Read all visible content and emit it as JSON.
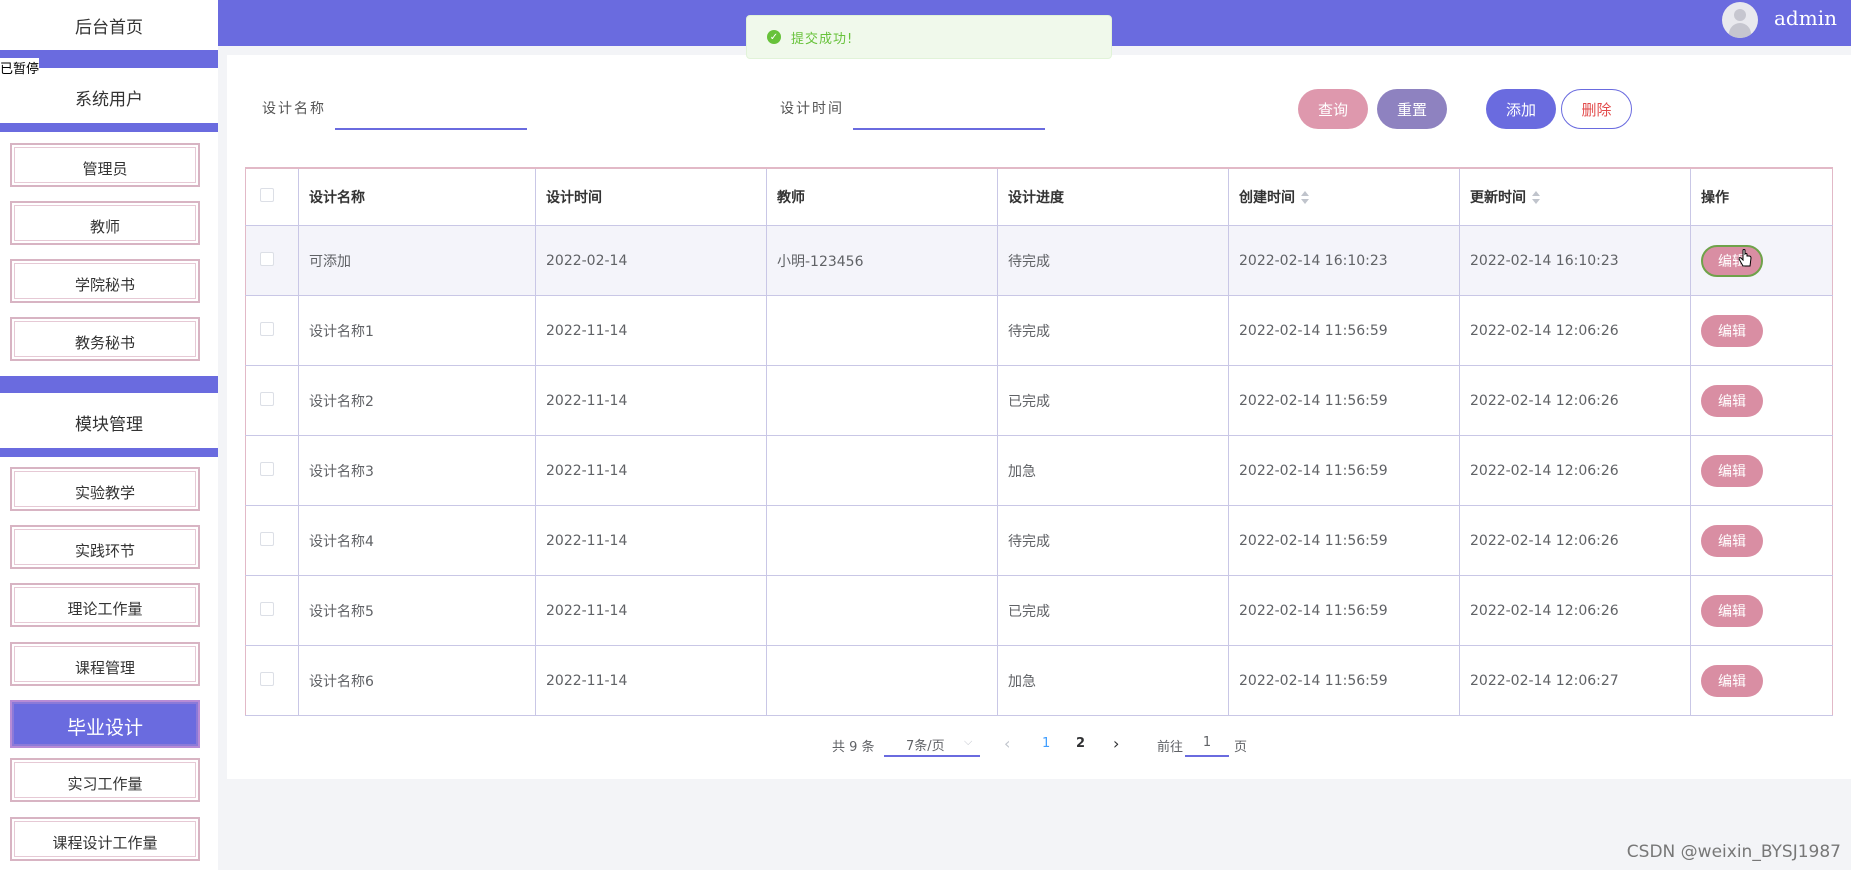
{
  "sidebar": {
    "home": "后台首页",
    "paused": "已暂停",
    "section_users": "系统用户",
    "users": [
      "管理员",
      "教师",
      "学院秘书",
      "教务秘书"
    ],
    "section_modules": "模块管理",
    "modules": [
      "实验教学",
      "实践环节",
      "理论工作量",
      "课程管理",
      "毕业设计",
      "实习工作量",
      "课程设计工作量"
    ],
    "active_module": "毕业设计"
  },
  "header": {
    "username": "admin",
    "bg_color": "#6a6bdf"
  },
  "toast": {
    "message": "提交成功!",
    "type": "success"
  },
  "filters": {
    "name_label": "设计名称",
    "name_value": "",
    "time_label": "设计时间",
    "time_value": ""
  },
  "buttons": {
    "query": "查询",
    "reset": "重置",
    "add": "添加",
    "delete": "删除"
  },
  "table": {
    "columns": [
      "设计名称",
      "设计时间",
      "教师",
      "设计进度",
      "创建时间",
      "更新时间",
      "操作"
    ],
    "edit_label": "编辑",
    "rows": [
      {
        "name": "可添加",
        "time": "2022-02-14",
        "teacher": "小明-123456",
        "progress": "待完成",
        "created": "2022-02-14 16:10:23",
        "updated": "2022-02-14 16:10:23"
      },
      {
        "name": "设计名称1",
        "time": "2022-11-14",
        "teacher": "",
        "progress": "待完成",
        "created": "2022-02-14 11:56:59",
        "updated": "2022-02-14 12:06:26"
      },
      {
        "name": "设计名称2",
        "time": "2022-11-14",
        "teacher": "",
        "progress": "已完成",
        "created": "2022-02-14 11:56:59",
        "updated": "2022-02-14 12:06:26"
      },
      {
        "name": "设计名称3",
        "time": "2022-11-14",
        "teacher": "",
        "progress": "加急",
        "created": "2022-02-14 11:56:59",
        "updated": "2022-02-14 12:06:26"
      },
      {
        "name": "设计名称4",
        "time": "2022-11-14",
        "teacher": "",
        "progress": "待完成",
        "created": "2022-02-14 11:56:59",
        "updated": "2022-02-14 12:06:26"
      },
      {
        "name": "设计名称5",
        "time": "2022-11-14",
        "teacher": "",
        "progress": "已完成",
        "created": "2022-02-14 11:56:59",
        "updated": "2022-02-14 12:06:26"
      },
      {
        "name": "设计名称6",
        "time": "2022-11-14",
        "teacher": "",
        "progress": "加急",
        "created": "2022-02-14 11:56:59",
        "updated": "2022-02-14 12:06:27"
      }
    ]
  },
  "pagination": {
    "total": "共 9 条",
    "page_size": "7条/页",
    "pages": [
      "1",
      "2"
    ],
    "current_page": "1",
    "goto_prefix": "前往",
    "goto_value": "1",
    "goto_suffix": "页"
  },
  "watermark": "CSDN @weixin_BYSJ1987"
}
